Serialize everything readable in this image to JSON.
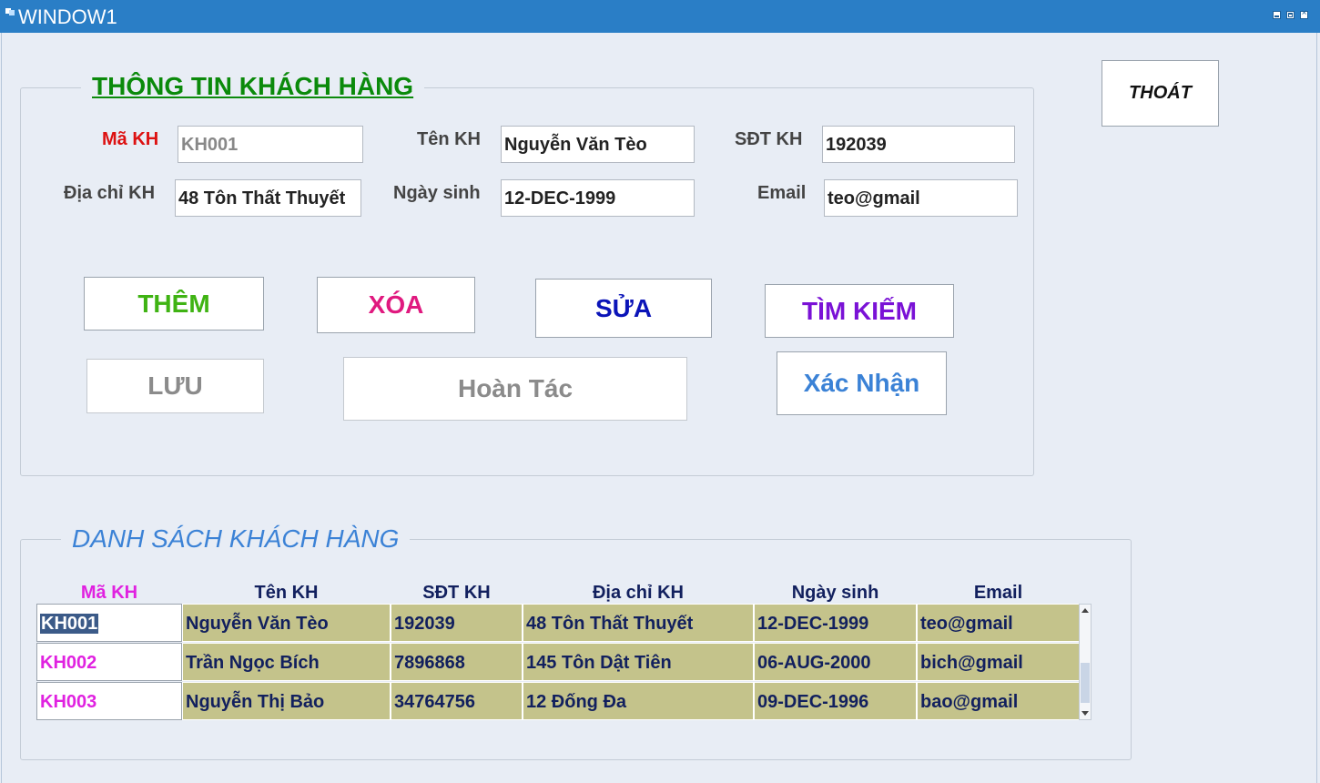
{
  "window": {
    "title": "WINDOW1",
    "controls": [
      "minimize",
      "maximize",
      "close"
    ]
  },
  "info_group": {
    "title": "THÔNG TIN KHÁCH HÀNG",
    "fields": {
      "ma_kh": {
        "label": "Mã KH",
        "value": "KH001"
      },
      "ten_kh": {
        "label": "Tên KH",
        "value": "Nguyễn Văn Tèo"
      },
      "sdt_kh": {
        "label": "SĐT KH",
        "value": "192039"
      },
      "dia_chi": {
        "label": "Địa chỉ KH",
        "value": "48 Tôn Thất Thuyết"
      },
      "ngay_sinh": {
        "label": "Ngày sinh",
        "value": "12-DEC-1999"
      },
      "email": {
        "label": "Email",
        "value": "teo@gmail"
      }
    },
    "buttons": {
      "them": "THÊM",
      "xoa": "XÓA",
      "sua": "SỬA",
      "tim_kiem": "TÌM KIẾM",
      "luu": "LƯU",
      "hoan_tac": "Hoàn Tác",
      "xac_nhan": "Xác Nhận"
    }
  },
  "exit_button": "THOÁT",
  "list_group": {
    "title": "DANH SÁCH KHÁCH HÀNG",
    "columns": [
      "Mã KH",
      "Tên KH",
      "SĐT KH",
      "Địa chỉ KH",
      "Ngày sinh",
      "Email"
    ],
    "rows": [
      [
        "KH001",
        "Nguyễn Văn Tèo",
        "192039",
        "48 Tôn Thất Thuyết",
        "12-DEC-1999",
        "teo@gmail"
      ],
      [
        "KH002",
        "Trần Ngọc Bích",
        "7896868",
        "145 Tôn Dật Tiên",
        "06-AUG-2000",
        "bich@gmail"
      ],
      [
        "KH003",
        "Nguyễn Thị Bảo",
        "34764756",
        "12 Đống Đa",
        "09-DEC-1996",
        "bao@gmail"
      ]
    ],
    "selected_row": 0
  },
  "colors": {
    "titlebar": "#2a7ec6",
    "background": "#e8edf5",
    "info_title": "#0b8a0b",
    "list_title": "#3b82d6",
    "label_required": "#dd1111",
    "btn_them": "#3fb313",
    "btn_xoa": "#e0197f",
    "btn_sua": "#0b14b8",
    "btn_tim_kiem": "#7a12d6",
    "btn_disabled": "#8b8b8b",
    "btn_xac_nhan": "#3b82d6",
    "table_cell": "#c4c38b",
    "table_text": "#12205e",
    "table_code": "#e022e0"
  }
}
